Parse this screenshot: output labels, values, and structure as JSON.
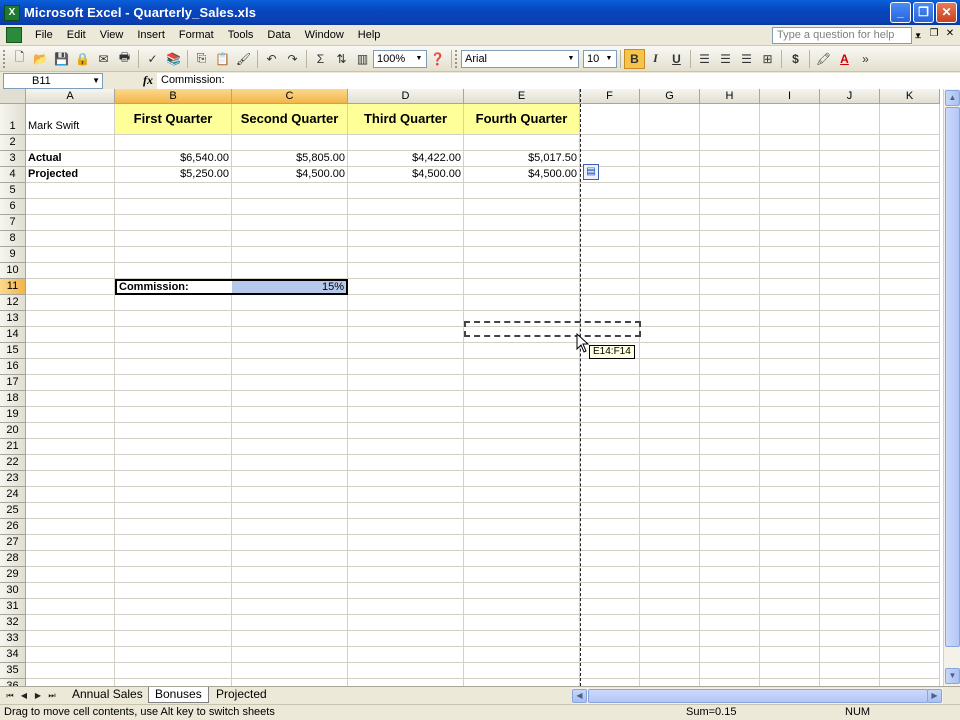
{
  "window": {
    "title": "Microsoft Excel - Quarterly_Sales.xls",
    "app_icon": "X"
  },
  "menu": [
    "File",
    "Edit",
    "View",
    "Insert",
    "Format",
    "Tools",
    "Data",
    "Window",
    "Help"
  ],
  "help_placeholder": "Type a question for help",
  "toolbar": {
    "zoom": "100%",
    "font": "Arial",
    "font_size": "10",
    "bold": "B",
    "italic": "I",
    "underline": "U",
    "currency": "$",
    "sum": "Σ"
  },
  "formula_bar": {
    "name_box": "B11",
    "fx": "fx",
    "content": "Commission:"
  },
  "columns": [
    "A",
    "B",
    "C",
    "D",
    "E",
    "F",
    "G",
    "H",
    "I",
    "J",
    "K"
  ],
  "rows": [
    "1",
    "2",
    "3",
    "4",
    "5",
    "6",
    "7",
    "8",
    "9",
    "10",
    "11",
    "12",
    "13",
    "14",
    "15",
    "16",
    "17",
    "18",
    "19",
    "20",
    "21",
    "22",
    "23",
    "24",
    "25",
    "26",
    "27",
    "28",
    "29",
    "30",
    "31",
    "32",
    "33",
    "34",
    "35",
    "36"
  ],
  "cells": {
    "A1": "Mark Swift",
    "B1": "First Quarter",
    "C1": "Second Quarter",
    "D1": "Third Quarter",
    "E1": "Fourth Quarter",
    "A3": "Actual",
    "B3": "$6,540.00",
    "C3": "$5,805.00",
    "D3": "$4,422.00",
    "E3": "$5,017.50",
    "A4": "Projected",
    "B4": "$5,250.00",
    "C4": "$4,500.00",
    "D4": "$4,500.00",
    "E4": "$4,500.00",
    "B11": "Commission:",
    "C11": "15%"
  },
  "drag_tip": "E14:F14",
  "sheets": [
    "Annual Sales",
    "Bonuses",
    "Projected"
  ],
  "active_sheet": "Bonuses",
  "status": {
    "message": "Drag to move cell contents, use Alt key to switch sheets",
    "sum": "Sum=0.15",
    "num": "NUM"
  }
}
